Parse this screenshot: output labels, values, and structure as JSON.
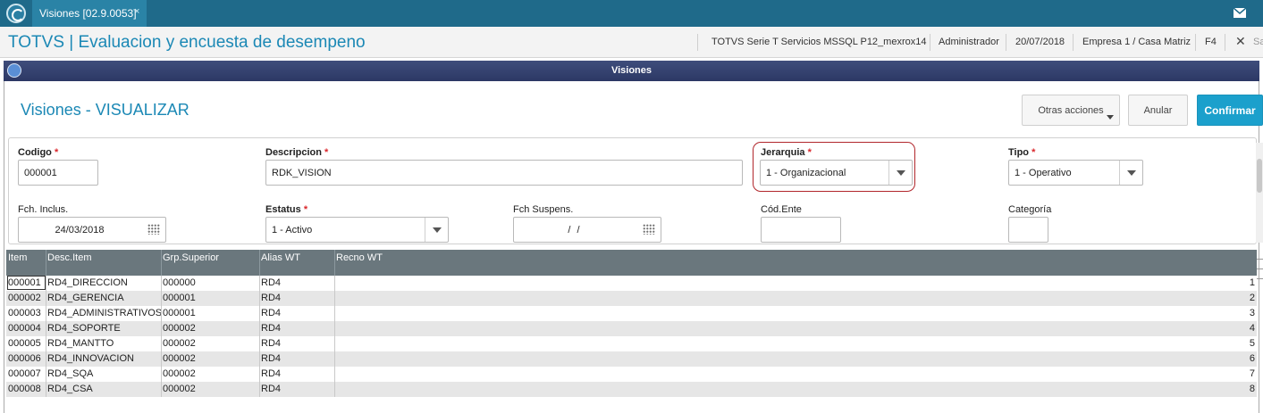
{
  "topbar": {
    "tab_label": "Visiones [02.9.0053]",
    "tab_close": "×",
    "mail_icon": "envelope-icon",
    "bg_color": "#1f6a8a"
  },
  "app_header": {
    "title": "TOTVS | Evaluacion y encuesta de desempeno",
    "environment": "TOTVS Serie T Servicios MSSQL P12_mexrox14",
    "user": "Administrador",
    "date": "20/07/2018",
    "company": "Empresa 1 / Casa Matriz",
    "help_key": "F4",
    "close_label": "✕",
    "truncated": "Sa"
  },
  "window": {
    "title": "Visiones"
  },
  "page": {
    "title": "Visiones - VISUALIZAR",
    "actions": {
      "other_actions": "Otras acciones",
      "cancel": "Anular",
      "confirm": "Confirmar"
    },
    "accent_color": "#1ba0cc"
  },
  "form": {
    "codigo": {
      "label": "Codigo",
      "value": "000001",
      "required": true
    },
    "descripcion": {
      "label": "Descripcion",
      "value": "RDK_VISION",
      "required": true
    },
    "jerarquia": {
      "label": "Jerarquia",
      "value": "1 - Organizacional",
      "required": true
    },
    "tipo": {
      "label": "Tipo",
      "value": "1 - Operativo",
      "required": true
    },
    "fch_inclus": {
      "label": "Fch. Inclus.",
      "value": "24/03/2018"
    },
    "estatus": {
      "label": "Estatus",
      "value": "1 - Activo",
      "required": true
    },
    "fch_suspens": {
      "label": "Fch Suspens.",
      "value": "/ /"
    },
    "cod_ente": {
      "label": "Cód.Ente",
      "value": ""
    },
    "categoria": {
      "label": "Categoría",
      "value": ""
    },
    "required_mark": "*"
  },
  "grid": {
    "columns": [
      "Item",
      "Desc.Item",
      "Grp.Superior",
      "Alias WT",
      "Recno WT"
    ],
    "rows": [
      [
        "000001",
        "RD4_DIRECCION",
        "000000",
        "RD4",
        "1"
      ],
      [
        "000002",
        "RD4_GERENCIA",
        "000001",
        "RD4",
        "2"
      ],
      [
        "000003",
        "RD4_ADMINISTRATIVOS",
        "000001",
        "RD4",
        "3"
      ],
      [
        "000004",
        "RD4_SOPORTE",
        "000002",
        "RD4",
        "4"
      ],
      [
        "000005",
        "RD4_MANTTO",
        "000002",
        "RD4",
        "5"
      ],
      [
        "000006",
        "RD4_INNOVACION",
        "000002",
        "RD4",
        "6"
      ],
      [
        "000007",
        "RD4_SQA",
        "000002",
        "RD4",
        "7"
      ],
      [
        "000008",
        "RD4_CSA",
        "000002",
        "RD4",
        "8"
      ]
    ],
    "header_color": "#6a777d"
  }
}
